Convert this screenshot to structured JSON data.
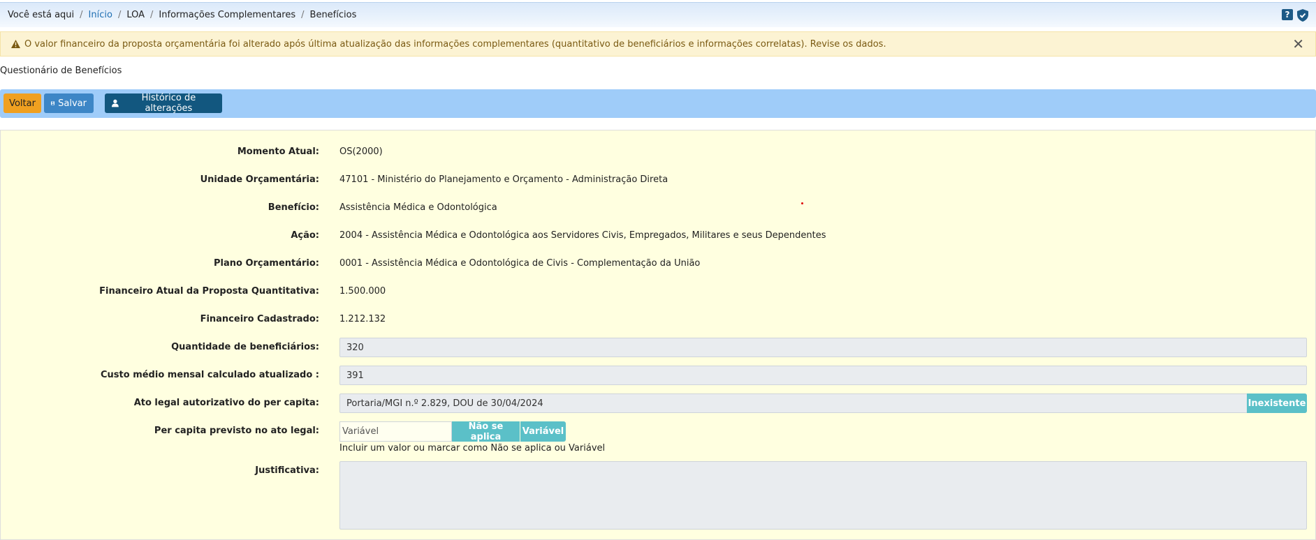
{
  "breadcrumb": {
    "prefix": "Você está aqui",
    "items": [
      "Início",
      "LOA",
      "Informações Complementares",
      "Benefícios"
    ],
    "help_glyph": "?"
  },
  "icons": {
    "help": "question-icon",
    "shield": "shield-check-icon",
    "alert": "warning-triangle-icon",
    "close": "close-icon",
    "save": "floppy-disk-icon",
    "user": "user-icon"
  },
  "colors": {
    "alert_bg": "#fcf3d3",
    "toolbar_bg": "#9fccf9",
    "voltar": "#f0a020",
    "salvar": "#3d86c6",
    "historico": "#12577f",
    "panel_bg": "#ffffe0",
    "addon": "#5bc0c8"
  },
  "alert": {
    "text": "O valor financeiro da proposta orçamentária foi alterado após última atualização das informações complementares (quantitativo de beneficiários e informações correlatas). Revise os dados.",
    "close_glyph": "✕"
  },
  "page_title": "Questionário de Benefícios",
  "toolbar": {
    "voltar": "Voltar",
    "salvar": "Salvar",
    "historico": "Histórico de alterações"
  },
  "form": {
    "momento_label": "Momento Atual:",
    "momento_value": "OS(2000)",
    "unidade_label": "Unidade Orçamentária:",
    "unidade_value": "47101 - Ministério do Planejamento e Orçamento - Administração Direta",
    "beneficio_label": "Benefício:",
    "beneficio_value": "Assistência Médica e Odontológica",
    "acao_label": "Ação:",
    "acao_value": "2004 - Assistência Médica e Odontológica aos Servidores Civis, Empregados, Militares e seus Dependentes",
    "plano_label": "Plano Orçamentário:",
    "plano_value": "0001 - Assistência Médica e Odontológica de Civis - Complementação da União",
    "fin_atual_label": "Financeiro Atual da Proposta Quantitativa:",
    "fin_atual_value": "1.500.000",
    "fin_cad_label": "Financeiro Cadastrado:",
    "fin_cad_value": "1.212.132",
    "qtd_label": "Quantidade de beneficiários:",
    "qtd_value": "320",
    "custo_label": "Custo médio mensal calculado atualizado :",
    "custo_value": "391",
    "ato_label": "Ato legal autorizativo do per capita:",
    "ato_value": "Portaria/MGI n.º 2.829, DOU de 30/04/2024",
    "ato_button": "Inexistente",
    "percapita_label": "Per capita previsto no ato legal:",
    "percapita_value": "Variável",
    "nao_se_aplica": "Não se aplica",
    "variavel": "Variável",
    "percapita_help": "Incluir um valor ou marcar como Não se aplica ou Variável",
    "justificativa_label": "Justificativa:",
    "justificativa_value": ""
  }
}
